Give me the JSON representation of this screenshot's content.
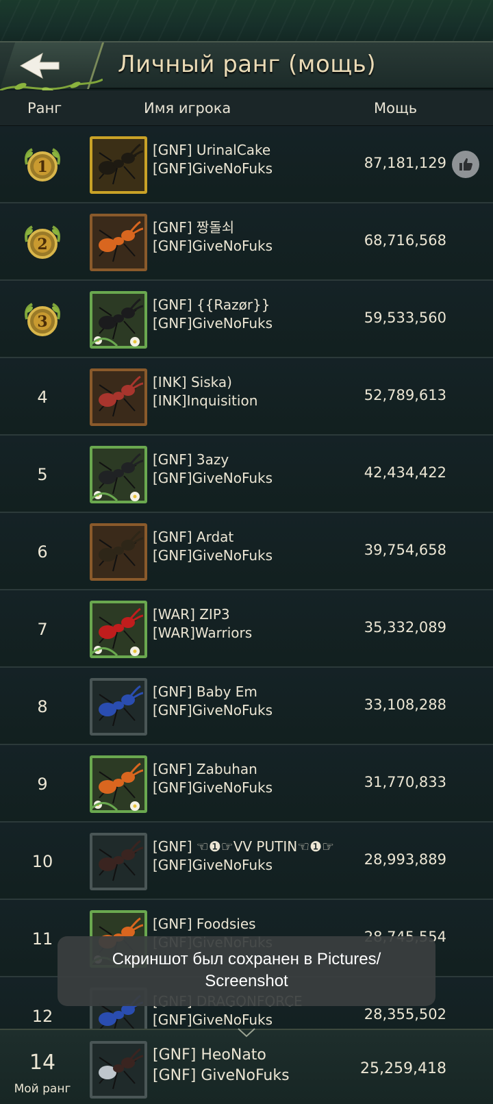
{
  "header": {
    "title": "Личный ранг (мощь)"
  },
  "columns": {
    "rank": "Ранг",
    "player": "Имя игрока",
    "power": "Мощь"
  },
  "rows": [
    {
      "rank": "1",
      "medal": true,
      "name": "[GNF] UrinalCake",
      "alliance": "[GNF]GiveNoFuks",
      "power": "87,181,129",
      "frame": "gold",
      "ant": "gold-soldier",
      "like": true
    },
    {
      "rank": "2",
      "medal": true,
      "name": "[GNF] 짱돌쇠",
      "alliance": "[GNF]GiveNoFuks",
      "power": "68,716,568",
      "frame": "wood",
      "ant": "orange-ant"
    },
    {
      "rank": "3",
      "medal": true,
      "name": "[GNF] {{Razør}}",
      "alliance": "[GNF]GiveNoFuks",
      "power": "59,533,560",
      "frame": "green",
      "ant": "black-stag"
    },
    {
      "rank": "4",
      "name": "[INK] Siska)",
      "alliance": "[INK]Inquisition",
      "power": "52,789,613",
      "frame": "wood",
      "ant": "red-ant"
    },
    {
      "rank": "5",
      "name": "[GNF] 3azy",
      "alliance": "[GNF]GiveNoFuks",
      "power": "42,434,422",
      "frame": "green",
      "ant": "black-ant"
    },
    {
      "rank": "6",
      "name": "[GNF] Ardat",
      "alliance": "[GNF]GiveNoFuks",
      "power": "39,754,658",
      "frame": "wood",
      "ant": "dark-ant"
    },
    {
      "rank": "7",
      "name": "[WAR] ZIP3",
      "alliance": "[WAR]Warriors",
      "power": "35,332,089",
      "frame": "green",
      "ant": "red-beetle"
    },
    {
      "rank": "8",
      "name": "[GNF] Baby Em",
      "alliance": "[GNF]GiveNoFuks",
      "power": "33,108,288",
      "frame": "plain",
      "ant": "blue-ant"
    },
    {
      "rank": "9",
      "name": "[GNF] Zabuhan",
      "alliance": "[GNF]GiveNoFuks",
      "power": "31,770,833",
      "frame": "green",
      "ant": "orange-ant"
    },
    {
      "rank": "10",
      "name": "[GNF] ☜❶☞VV PUTIN☜❶☞",
      "alliance": "[GNF]GiveNoFuks",
      "power": "28,993,889",
      "frame": "plain",
      "ant": "stag-beetle"
    },
    {
      "rank": "11",
      "name": "[GNF] Foodsies",
      "alliance": "[GNF]GiveNoFuks",
      "power": "28,745,554",
      "frame": "green",
      "ant": "orange-ant"
    },
    {
      "rank": "12",
      "name": "[GNF] DRAGONFORCE",
      "alliance": "[GNF]GiveNoFuks",
      "power": "28,355,502",
      "frame": "plain",
      "ant": "blue-ant"
    }
  ],
  "toast": {
    "line1": "Скриншот был сохранен в  Pictures/",
    "line2": "Screenshot"
  },
  "my_rank": {
    "rank": "14",
    "label": "Мой ранг",
    "name": "[GNF] HeoNato",
    "alliance": "[GNF] GiveNoFuks",
    "power": "25,259,418"
  },
  "colors": {
    "gold": "#c9a227",
    "wood": "#8a5a2b",
    "green": "#6aa84f",
    "plain": "#4a5656",
    "bg": "#12201f"
  }
}
